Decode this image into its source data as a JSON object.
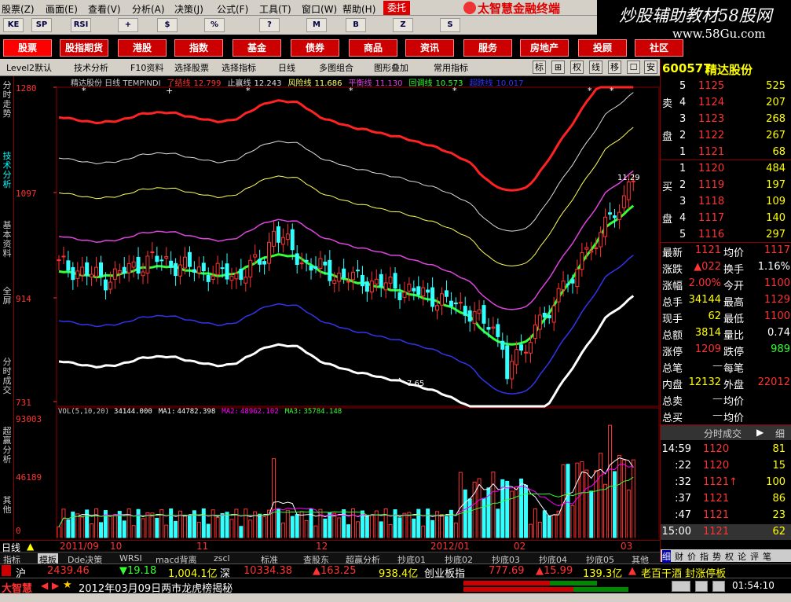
{
  "menu": {
    "items": [
      "股票(Z)",
      "画面(E)",
      "查看(V)",
      "分析(A)",
      "决策(J)",
      "公式(F)",
      "工具(T)",
      "窗口(W)",
      "帮助(H)"
    ],
    "hot": "委托",
    "brand": "太智慧金融终端"
  },
  "banner": {
    "slogan": "炒股辅助教材58股网",
    "url": "www.58Gu.com"
  },
  "iconbar": [
    "KE",
    "SP",
    "RSI",
    "+",
    "$",
    "%",
    "?",
    "M",
    "B",
    "Z",
    "S"
  ],
  "navbar": [
    "股票",
    "股指期货",
    "港股",
    "指数",
    "基金",
    "债券",
    "商品",
    "资讯",
    "服务",
    "房地产",
    "投顾",
    "社区"
  ],
  "toolbar": {
    "items": [
      "Level2默认",
      "技术分析",
      "F10资料",
      "选择股票",
      "选择指标",
      "日线",
      "多图组合",
      "图形叠加",
      "常用指标"
    ],
    "icons": [
      "标",
      "⊞",
      "权",
      "线",
      "移",
      "☐",
      "安"
    ]
  },
  "left_tabs": [
    "分时走势",
    "技术分析",
    "基本资料",
    "全屏",
    "分时成交",
    "超赢分析",
    "其他"
  ],
  "chart_data": {
    "type": "candlestick",
    "title": "精达股份 日线 TEMPINDI",
    "indicators": [
      {
        "name": "了结线",
        "value": "12.799",
        "color": "#ff3333"
      },
      {
        "name": "止赢线",
        "value": "12.243",
        "color": "#dddddd"
      },
      {
        "name": "风险线",
        "value": "11.686",
        "color": "#ffff66"
      },
      {
        "name": "平衡线",
        "value": "11.130",
        "color": "#dd44dd"
      },
      {
        "name": "回调线",
        "value": "10.573",
        "color": "#33ff33"
      },
      {
        "name": "超跌线",
        "value": "10.017",
        "color": "#3333ff"
      }
    ],
    "y_labels": [
      "1280",
      "1097",
      "914",
      "731"
    ],
    "ylim": [
      7.31,
      12.8
    ],
    "annotations": {
      "low": "7.65",
      "high": "11.29"
    },
    "x_labels": [
      "2011/09",
      "10",
      "11",
      "12",
      "2012/01",
      "02",
      "03"
    ],
    "volume": {
      "title": "VOL(5,10,20)",
      "value": "34144.000",
      "ma1": "44782.398",
      "ma2": "48962.102",
      "ma3": "35784.148",
      "y_labels": [
        "93003",
        "46189",
        "0"
      ],
      "ma_labels": [
        "MA1:",
        "MA2:",
        "MA3:"
      ]
    },
    "period": "日线"
  },
  "quote": {
    "code": "600577",
    "name": "精达股份",
    "sell_label": [
      "卖",
      "盘"
    ],
    "buy_label": [
      "买",
      "盘"
    ],
    "sell": [
      {
        "level": "5",
        "price": "1125",
        "vol": "525"
      },
      {
        "level": "4",
        "price": "1124",
        "vol": "207"
      },
      {
        "level": "3",
        "price": "1123",
        "vol": "268"
      },
      {
        "level": "2",
        "price": "1122",
        "vol": "267"
      },
      {
        "level": "1",
        "price": "1121",
        "vol": "68"
      }
    ],
    "buy": [
      {
        "level": "1",
        "price": "1120",
        "vol": "484"
      },
      {
        "level": "2",
        "price": "1119",
        "vol": "197"
      },
      {
        "level": "3",
        "price": "1118",
        "vol": "109"
      },
      {
        "level": "4",
        "price": "1117",
        "vol": "140"
      },
      {
        "level": "5",
        "price": "1116",
        "vol": "297"
      }
    ],
    "stats": [
      {
        "l1": "最新",
        "v1": "1121",
        "l2": "均价",
        "v2": "1117"
      },
      {
        "l1": "涨跌",
        "v1": "▲022",
        "l2": "换手",
        "v2": "1.16%"
      },
      {
        "l1": "涨幅",
        "v1": "2.00%",
        "l2": "今开",
        "v2": "1100"
      },
      {
        "l1": "总手",
        "v1": "34144",
        "l2": "最高",
        "v2": "1129"
      },
      {
        "l1": "现手",
        "v1": "62",
        "l2": "最低",
        "v2": "1100"
      },
      {
        "l1": "总额",
        "v1": "3814",
        "l2": "量比",
        "v2": "0.74"
      },
      {
        "l1": "涨停",
        "v1": "1209",
        "l2": "跌停",
        "v2": "989"
      },
      {
        "l1": "总笔",
        "v1": "",
        "l2": "每笔",
        "v2": ""
      },
      {
        "l1": "内盘",
        "v1": "12132",
        "l2": "外盘",
        "v2": "22012"
      },
      {
        "l1": "总卖",
        "v1": "",
        "l2": "均价",
        "v2": ""
      },
      {
        "l1": "总买",
        "v1": "",
        "l2": "均价",
        "v2": ""
      }
    ],
    "ticks_title": "分时成交",
    "ticks_more": "细",
    "ticks": [
      {
        "t": "14:59",
        "p": "1120",
        "v": "81"
      },
      {
        "t": ":22",
        "p": "1120",
        "v": "15"
      },
      {
        "t": ":32",
        "p": "1121↑",
        "v": "100"
      },
      {
        "t": ":37",
        "p": "1121",
        "v": "86"
      },
      {
        "t": ":47",
        "p": "1121",
        "v": "23"
      },
      {
        "t": "15:00",
        "p": "1121",
        "v": "62"
      }
    ],
    "bottom_tabs": [
      "细",
      "财",
      "价",
      "指",
      "势",
      "权",
      "论",
      "评",
      "笔"
    ]
  },
  "bottom_tabs": [
    "指标",
    "模板",
    "Dde决策",
    "WRSI",
    "macd背离",
    "zscl",
    "标准",
    "查股东",
    "超赢分析",
    "抄底01",
    "抄底02",
    "抄底03",
    "抄底04",
    "抄底05",
    "其他"
  ],
  "status1": {
    "sh_label": "沪",
    "sh_index": "2439.46",
    "sh_change": "▼19.18",
    "sh_amount": "1,004.1亿",
    "sz_label": "深",
    "sz_index": "10334.38",
    "sz_change": "▲163.25",
    "sz_amount": "938.4亿",
    "cy_label": "创业板指",
    "cy_index": "777.69",
    "cy_change": "▲15.99",
    "cy_amount": "139.3亿",
    "news": "老百干酒 封涨停板"
  },
  "status2": {
    "logo": "大智慧",
    "date_news": "2012年03月09日两市龙虎榜揭秘",
    "time": "01:54:10"
  },
  "colors": {
    "up": "#ff3333",
    "down": "#33ffff",
    "gold": "#ffff00",
    "panel": "#d4d0c8"
  }
}
